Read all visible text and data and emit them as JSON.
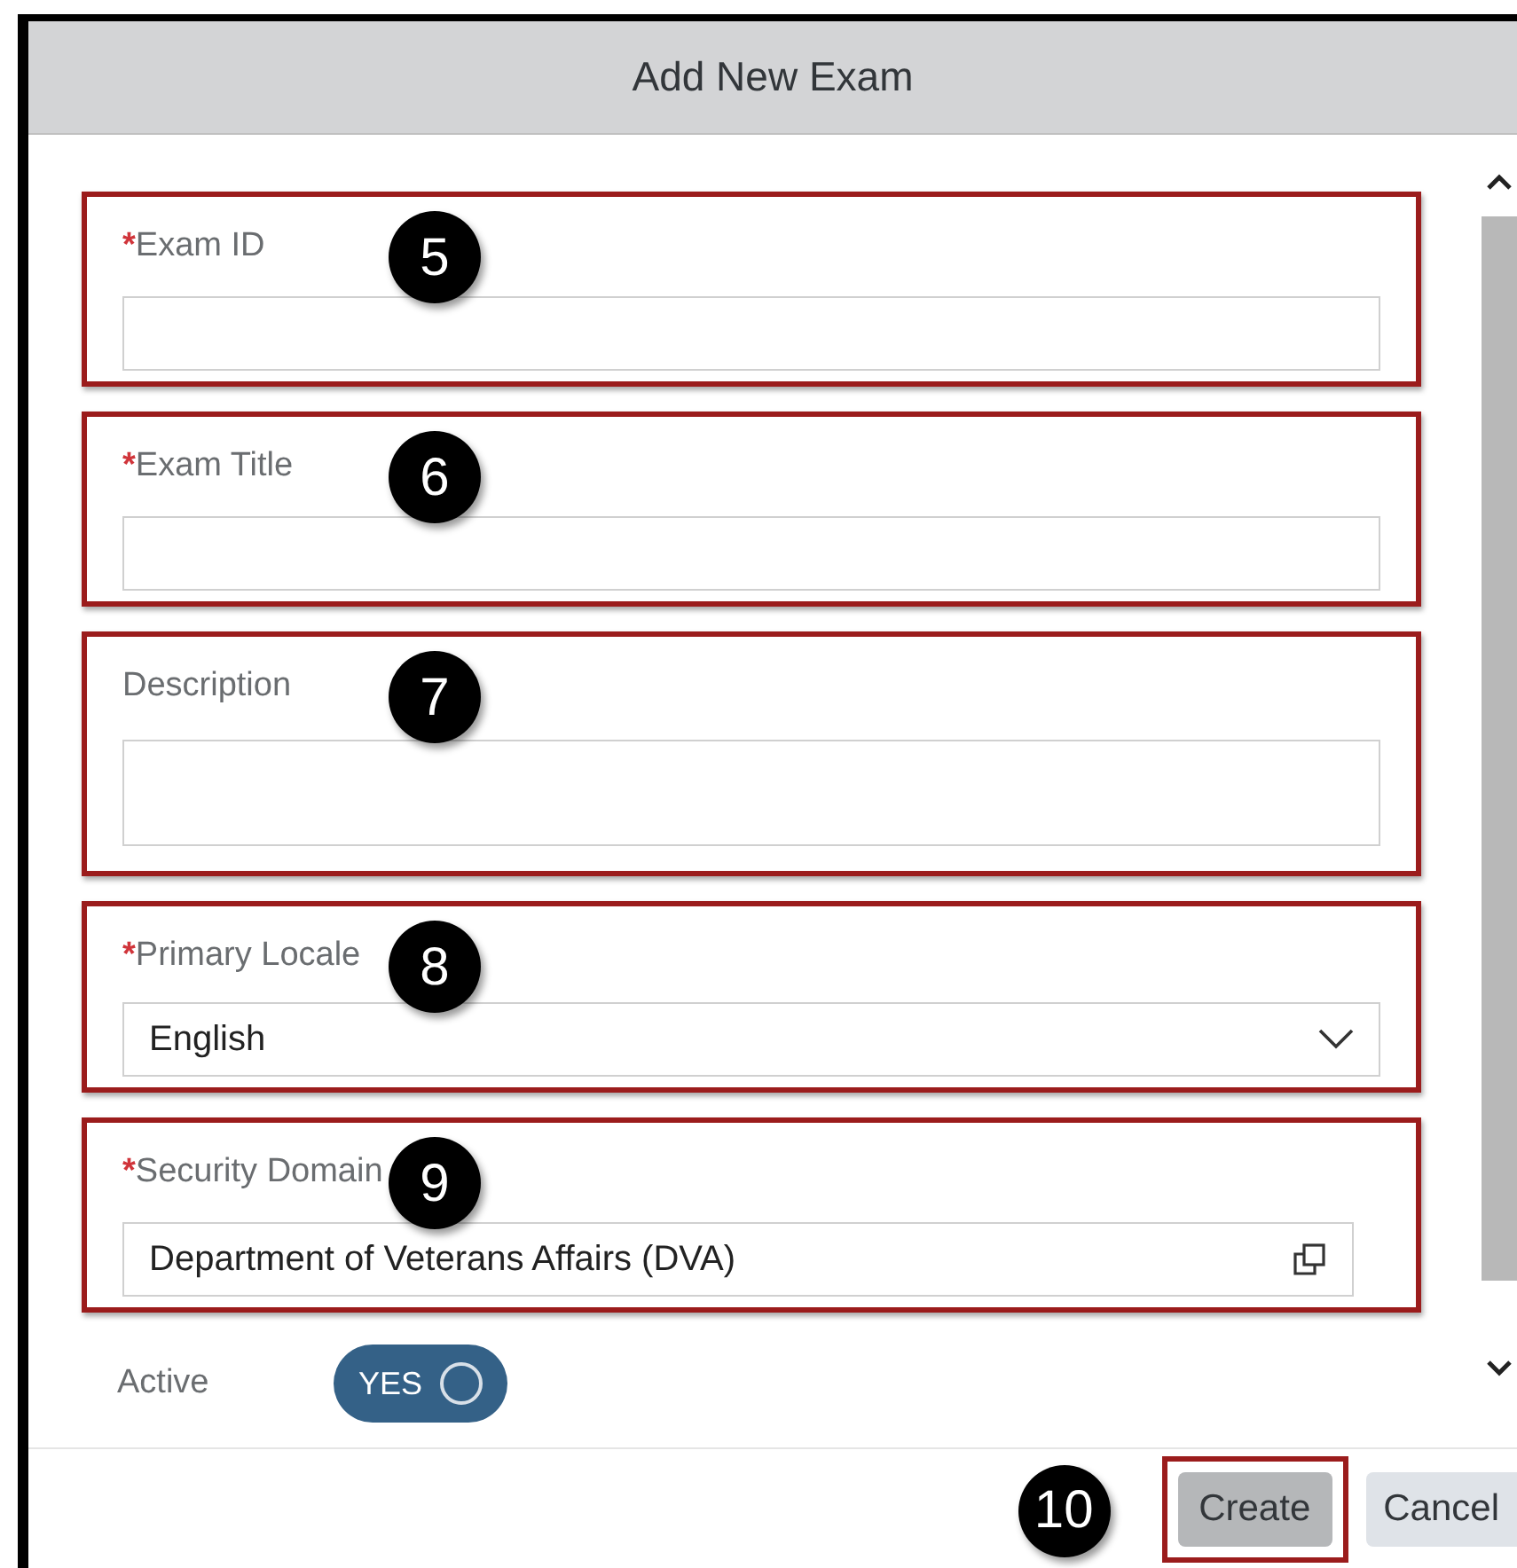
{
  "dialog": {
    "title": "Add New Exam"
  },
  "required_symbol": "*",
  "fields": [
    {
      "label": "Exam ID",
      "required": true,
      "kind": "text",
      "callout": "5"
    },
    {
      "label": "Exam Title",
      "required": true,
      "kind": "text",
      "callout": "6"
    },
    {
      "label": "Description",
      "required": false,
      "kind": "textarea",
      "callout": "7"
    },
    {
      "label": "Primary Locale",
      "required": true,
      "kind": "select",
      "value": "English",
      "callout": "8"
    },
    {
      "label": "Security Domain",
      "required": true,
      "kind": "lookup",
      "value": "Department of Veterans Affairs (DVA)",
      "callout": "9"
    }
  ],
  "active": {
    "label": "Active",
    "on": true,
    "text": "YES"
  },
  "buttons": [
    {
      "label": "Create",
      "kind": "primary",
      "callout": "10"
    },
    {
      "label": "Cancel",
      "kind": "secondary"
    }
  ]
}
